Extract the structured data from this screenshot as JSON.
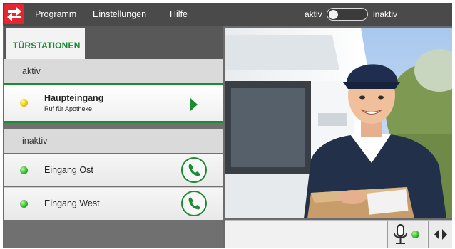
{
  "menu": {
    "items": [
      "Programm",
      "Einstellungen",
      "Hilfe"
    ],
    "toggle_left_label": "aktiv",
    "toggle_right_label": "inaktiv"
  },
  "sidebar": {
    "tab_label": "TÜRSTATIONEN",
    "active_header": "aktiv",
    "inactive_header": "inaktiv",
    "active_station": {
      "name": "Haupteingang",
      "subtitle": "Ruf für Apotheke",
      "led_color": "#e8c400"
    },
    "inactive_stations": [
      {
        "name": "Eingang Ost",
        "led_color": "#2fb524"
      },
      {
        "name": "Eingang West",
        "led_color": "#2fb524"
      }
    ]
  },
  "theme": {
    "accent": "#1d8a34",
    "brand": "#e3262f",
    "topbar_bg": "#4a4a4a",
    "panel_bg": "#707070"
  },
  "video": {
    "description_icon": "camera-feed"
  },
  "controls": {
    "mic_icon": "microphone-icon",
    "mic_status_led": "#2fb524",
    "nav_icon": "left-right-arrows-icon"
  }
}
